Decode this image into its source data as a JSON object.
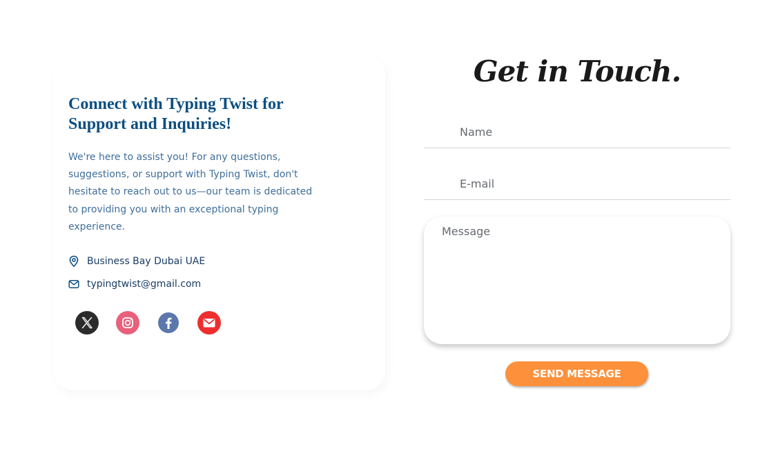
{
  "info": {
    "heading": "Connect with Typing Twist for Support and Inquiries!",
    "description": "We're here to assist you! For any questions, suggestions, or support with Typing Twist, don't hesitate to reach out to us—our team is dedicated to providing you with an exceptional typing experience.",
    "location": {
      "icon": "map-pin-icon",
      "text": "Business Bay Dubai UAE"
    },
    "email": {
      "icon": "mail-icon",
      "text": "typingtwist@gmail.com"
    }
  },
  "social": [
    {
      "name": "x-icon",
      "color": "#2b2b2b"
    },
    {
      "name": "instagram-icon",
      "color": "#e8607c"
    },
    {
      "name": "facebook-icon",
      "color": "#5b77ac"
    },
    {
      "name": "email-icon",
      "color": "#ee2e2e"
    }
  ],
  "form": {
    "title": "Get in Touch.",
    "name_placeholder": "Name",
    "email_placeholder": "E-mail",
    "message_placeholder": "Message",
    "send_label": "SEND MESSAGE",
    "button_color": "#fd903a"
  },
  "colors": {
    "heading": "#0c4e80",
    "text": "#3f6e9a"
  }
}
